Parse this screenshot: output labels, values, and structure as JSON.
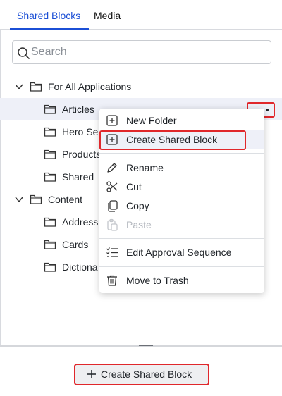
{
  "tabs": [
    {
      "label": "Shared Blocks",
      "active": true
    },
    {
      "label": "Media",
      "active": false
    }
  ],
  "search": {
    "placeholder": "Search",
    "value": ""
  },
  "tree": {
    "root1": {
      "label": "For All Applications",
      "expanded": true
    },
    "root1_children": [
      "Articles",
      "Hero Se",
      "Products",
      "Shared"
    ],
    "root2": {
      "label": "Content",
      "expanded": true
    },
    "root2_children": [
      "Address",
      "Cards",
      "Dictiona"
    ],
    "selected": "Articles"
  },
  "context_menu": {
    "items": [
      {
        "label": "New Folder",
        "icon": "new-folder-icon",
        "disabled": false
      },
      {
        "label": "Create Shared Block",
        "icon": "create-block-icon",
        "disabled": false
      },
      {
        "label": "Rename",
        "icon": "pencil-icon",
        "disabled": false
      },
      {
        "label": "Cut",
        "icon": "scissors-icon",
        "disabled": false
      },
      {
        "label": "Copy",
        "icon": "copy-icon",
        "disabled": false
      },
      {
        "label": "Paste",
        "icon": "paste-icon",
        "disabled": true
      },
      {
        "label": "Edit Approval Sequence",
        "icon": "approval-list-icon",
        "disabled": false
      },
      {
        "label": "Move to Trash",
        "icon": "trash-icon",
        "disabled": false
      }
    ]
  },
  "footer": {
    "create_label": "Create Shared Block"
  },
  "colors": {
    "accent": "#1b4fd6",
    "highlight_box": "#e0272b",
    "selected_row": "#eef0f8"
  }
}
